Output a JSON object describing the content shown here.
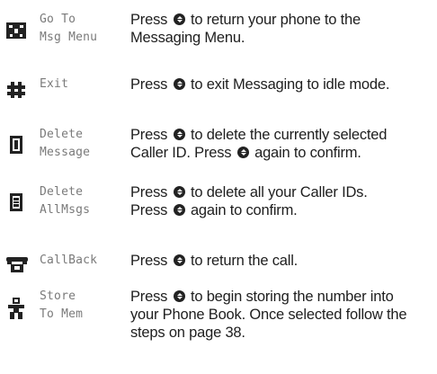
{
  "rows": [
    {
      "icon": "go-to-menu-icon",
      "label": [
        "Go To",
        "Msg Menu"
      ],
      "desc": [
        [
          "Press ",
          "",
          " to return your phone to the"
        ],
        [
          "Messaging Menu."
        ]
      ]
    },
    {
      "icon": "exit-icon",
      "label": [
        "Exit"
      ],
      "desc": [
        [
          "Press ",
          "",
          " to exit Messaging to idle mode."
        ]
      ]
    },
    {
      "icon": "delete-message-icon",
      "label": [
        "Delete",
        "Message"
      ],
      "desc": [
        [
          "Press ",
          "",
          " to delete the currently selected"
        ],
        [
          "Caller ID. Press ",
          "",
          " again to confirm."
        ]
      ]
    },
    {
      "icon": "delete-all-icon",
      "label": [
        "Delete",
        "AllMsgs"
      ],
      "desc": [
        [
          "Press ",
          "",
          " to delete all your Caller IDs."
        ],
        [
          "Press ",
          "",
          " again to confirm."
        ]
      ]
    },
    {
      "icon": "callback-phone-icon",
      "label": [
        "CallBack"
      ],
      "desc": [
        [
          "Press ",
          "",
          " to return the call."
        ]
      ]
    },
    {
      "icon": "store-person-icon",
      "label": [
        "Store",
        "To Mem"
      ],
      "desc": [
        [
          "Press ",
          "",
          " to begin storing the number into"
        ],
        [
          "your Phone Book. Once selected follow the"
        ],
        [
          "steps on page 38."
        ]
      ]
    }
  ]
}
